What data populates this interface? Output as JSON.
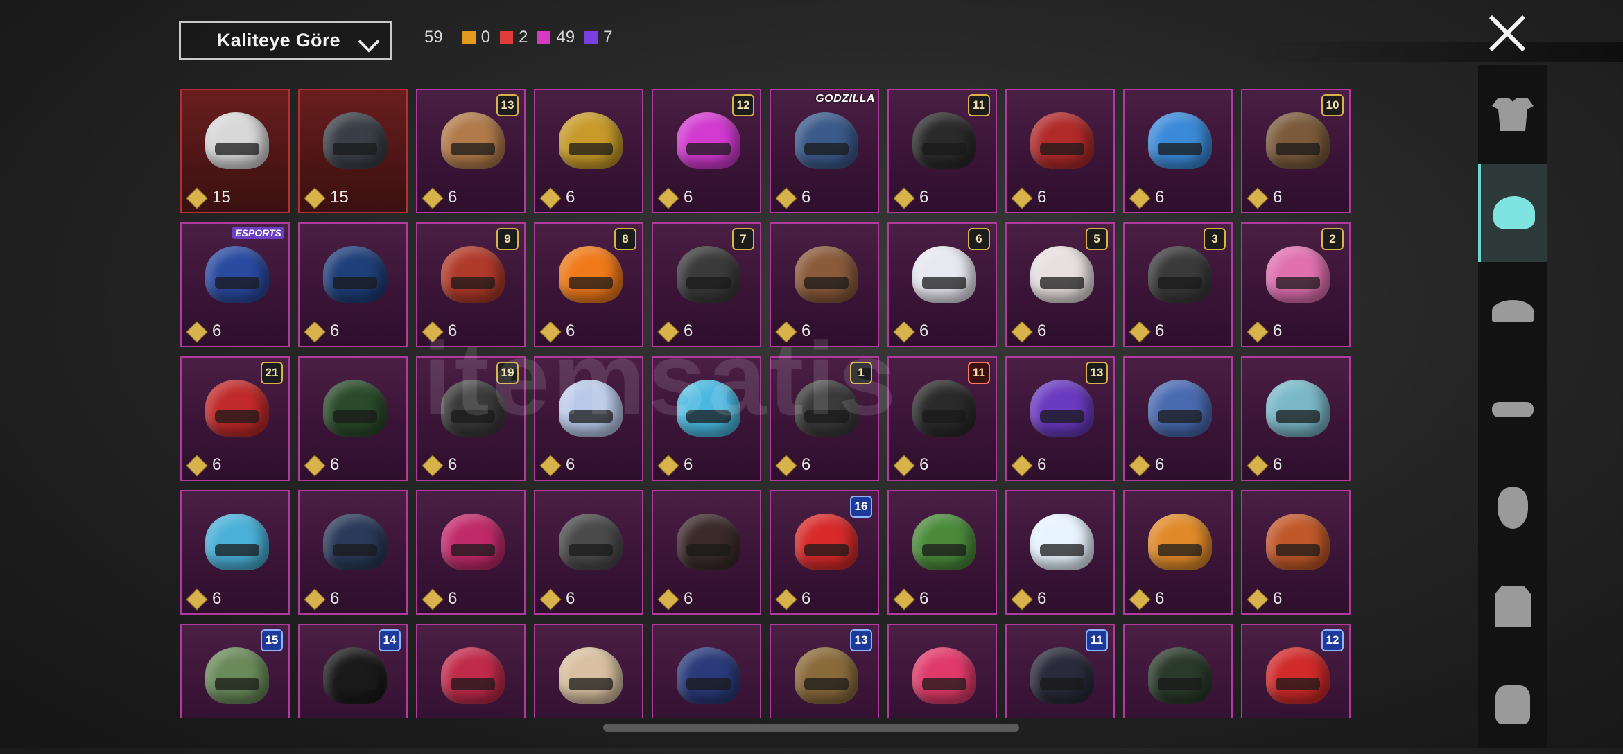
{
  "sort": {
    "label": "Kaliteye Göre"
  },
  "stats": {
    "total": "59",
    "counts": [
      {
        "value": "0",
        "color": "#e39a1e"
      },
      {
        "value": "2",
        "color": "#e03a3a"
      },
      {
        "value": "49",
        "color": "#d43bc2"
      },
      {
        "value": "7",
        "color": "#7a3fe0"
      }
    ]
  },
  "watermark": "itemsatis",
  "colors": {
    "rare_border": "#b03a9e",
    "red_border": "#b43030",
    "coin": "#d8b24a",
    "active_tab": "#7fe3df"
  },
  "sidebar": [
    {
      "icon": "outfit-icon",
      "active": false
    },
    {
      "icon": "helmet-icon",
      "active": true
    },
    {
      "icon": "cap-icon",
      "active": false
    },
    {
      "icon": "glasses-icon",
      "active": false
    },
    {
      "icon": "mask-icon",
      "active": false
    },
    {
      "icon": "jacket-icon",
      "active": false
    },
    {
      "icon": "backpack-icon",
      "active": false
    }
  ],
  "items": [
    {
      "price": "15",
      "rarity": "red",
      "color": "#d8d8d8"
    },
    {
      "price": "15",
      "rarity": "red",
      "color": "#3a3f47"
    },
    {
      "price": "6",
      "badge": "13",
      "color": "#b07a4a"
    },
    {
      "price": "6",
      "color": "#c79a2a"
    },
    {
      "price": "6",
      "badge": "12",
      "color": "#d23ad0"
    },
    {
      "price": "6",
      "tag": "GODZILLA",
      "color": "#3a5a8a"
    },
    {
      "price": "6",
      "badge": "11",
      "color": "#2a2a2a"
    },
    {
      "price": "6",
      "color": "#b02a2a"
    },
    {
      "price": "6",
      "color": "#3a8ad8"
    },
    {
      "price": "6",
      "badge": "10",
      "color": "#7a5a3a"
    },
    {
      "price": "6",
      "tag": "ESPORTS",
      "color": "#2a4aa0"
    },
    {
      "price": "6",
      "color": "#1f3f7a"
    },
    {
      "price": "6",
      "badge": "9",
      "color": "#b03a2a"
    },
    {
      "price": "6",
      "badge": "8",
      "color": "#f07a1a"
    },
    {
      "price": "6",
      "badge": "7",
      "color": "#3a3a3a"
    },
    {
      "price": "6",
      "color": "#8a5a3a"
    },
    {
      "price": "6",
      "badge": "6",
      "color": "#e8e8f0"
    },
    {
      "price": "6",
      "badge": "5",
      "color": "#e8e0e0"
    },
    {
      "price": "6",
      "badge": "3",
      "color": "#3a3a3a"
    },
    {
      "price": "6",
      "badge": "2",
      "color": "#e070b0"
    },
    {
      "price": "6",
      "badge": "21",
      "color": "#c02a2a"
    },
    {
      "price": "6",
      "color": "#2a4a2a"
    },
    {
      "price": "6",
      "badge": "19",
      "color": "#3a3a3a"
    },
    {
      "price": "6",
      "color": "#b8c8e8"
    },
    {
      "price": "6",
      "color": "#4ab8e0"
    },
    {
      "price": "6",
      "badge": "1",
      "color": "#3a3a3a"
    },
    {
      "price": "6",
      "badge": "11",
      "badgeStyle": "red",
      "color": "#2a2a2a"
    },
    {
      "price": "6",
      "badge": "13",
      "color": "#6a3ac0"
    },
    {
      "price": "6",
      "color": "#4a6ab0"
    },
    {
      "price": "6",
      "color": "#7ab8c8"
    },
    {
      "price": "6",
      "color": "#4ab0d8"
    },
    {
      "price": "6",
      "color": "#2a3a5a"
    },
    {
      "price": "6",
      "color": "#c02a6a"
    },
    {
      "price": "6",
      "color": "#4a4a4a"
    },
    {
      "price": "6",
      "color": "#3a2a2a"
    },
    {
      "price": "6",
      "badge": "16",
      "badgeStyle": "blue",
      "color": "#d82a2a"
    },
    {
      "price": "6",
      "color": "#4a8a3a"
    },
    {
      "price": "6",
      "color": "#e8f4ff"
    },
    {
      "price": "6",
      "color": "#e08a2a"
    },
    {
      "price": "6",
      "color": "#c0582a"
    },
    {
      "price": "",
      "badge": "15",
      "badgeStyle": "blue",
      "color": "#6a8a5a"
    },
    {
      "price": "",
      "badge": "14",
      "badgeStyle": "blue",
      "color": "#1a1a1a"
    },
    {
      "price": "",
      "color": "#c02a4a"
    },
    {
      "price": "",
      "color": "#d8c0a0"
    },
    {
      "price": "",
      "color": "#2a3a7a"
    },
    {
      "price": "",
      "badge": "13",
      "badgeStyle": "blue",
      "color": "#8a6a3a"
    },
    {
      "price": "",
      "color": "#e03a6a"
    },
    {
      "price": "",
      "badge": "11",
      "badgeStyle": "blue",
      "color": "#2a2a3a"
    },
    {
      "price": "",
      "color": "#2a3a2a"
    },
    {
      "price": "",
      "badge": "12",
      "badgeStyle": "blue",
      "color": "#d02a2a"
    }
  ]
}
